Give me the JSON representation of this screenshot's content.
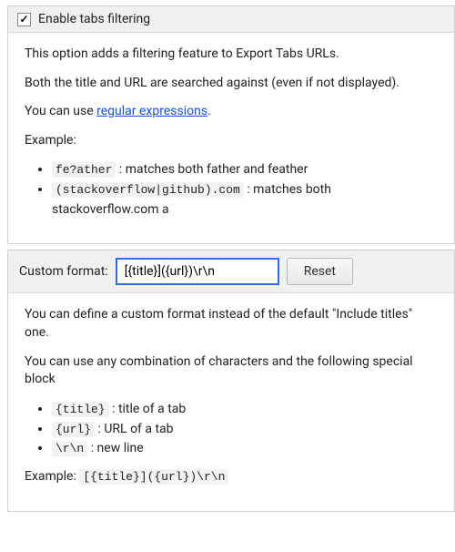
{
  "filtering": {
    "checkbox_label": "Enable tabs filtering",
    "checked": true,
    "desc1": "This option adds a filtering feature to Export Tabs URLs.",
    "desc2": "Both the title and URL are searched against (even if not displayed).",
    "desc3_prefix": "You can use ",
    "desc3_link": "regular expressions",
    "desc3_suffix": ".",
    "example_label": "Example:",
    "examples": [
      {
        "code": "fe?ather",
        "text": " : matches both father and feather"
      },
      {
        "code": "(stackoverflow|github).com",
        "text": " : matches both stackoverflow.com a"
      }
    ]
  },
  "custom_format": {
    "label": "Custom format:",
    "value": "[{title}]({url})\\r\\n",
    "reset_label": "Reset",
    "desc1": "You can define a custom format instead of the default \"Include titles\" one.",
    "desc2": "You can use any combination of characters and the following special block",
    "blocks": [
      {
        "code": "{title}",
        "text": " : title of a tab"
      },
      {
        "code": "{url}",
        "text": " : URL of a tab"
      },
      {
        "code": "\\r\\n",
        "text": " : new line"
      }
    ],
    "example_label": "Example: ",
    "example_code": "[{title}]({url})\\r\\n"
  }
}
